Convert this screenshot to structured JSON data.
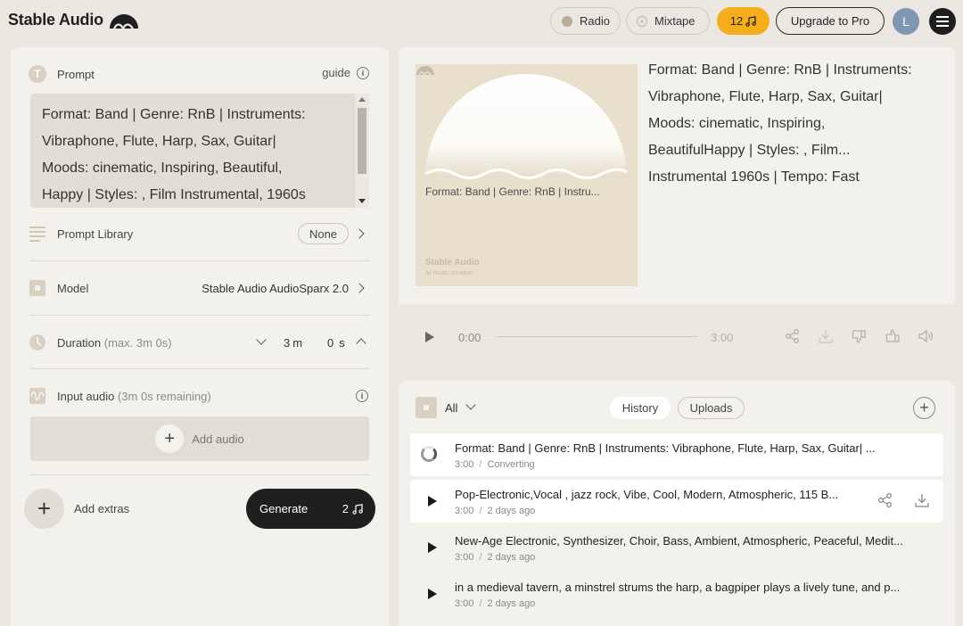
{
  "app": {
    "name": "Stable Audio"
  },
  "topbar": {
    "radio_label": "Radio",
    "mixtape_label": "Mixtape",
    "credits": "12",
    "upgrade_label": "Upgrade to Pro",
    "avatar_initial": "L"
  },
  "prompt": {
    "label": "Prompt",
    "icon_letter": "T",
    "guide_label": "guide",
    "text_lines": [
      "Format: Band | Genre: RnB | Instruments:",
      "Vibraphone, Flute, Harp, Sax, Guitar|",
      "Moods: cinematic, Inspiring, Beautiful,",
      "Happy  | Styles: , Film Instrumental,   1960s"
    ]
  },
  "settings": {
    "prompt_library_label": "Prompt Library",
    "prompt_library_value": "None",
    "model_label": "Model",
    "model_value": "Stable Audio AudioSparx 2.0",
    "duration_label": "Duration",
    "duration_hint": "(max. 3m 0s)",
    "duration_minutes": "3",
    "duration_minutes_unit": "m",
    "duration_seconds": "0",
    "duration_seconds_unit": "s",
    "input_audio_label": "Input audio",
    "input_audio_hint": "(3m 0s remaining)",
    "add_audio_label": "Add audio"
  },
  "actions": {
    "add_extras_label": "Add extras",
    "generate_label": "Generate",
    "generate_cost": "2"
  },
  "player": {
    "cover_caption": "Format: Band | Genre: RnB | Instru...",
    "cover_brand": "Stable Audio",
    "cover_sub": "AI music creation",
    "description_lines": [
      "Format: Band | Genre: RnB | Instruments:",
      "Vibraphone, Flute, Harp, Sax, Guitar|",
      "Moods: cinematic, Inspiring,",
      "BeautifulHappy | Styles: , Film...",
      "Instrumental 1960s | Tempo: Fast"
    ],
    "current_time": "0:00",
    "total_time": "3:00"
  },
  "history": {
    "filter_label": "All",
    "tab_history": "History",
    "tab_uploads": "Uploads",
    "meta_separator": "/",
    "items": [
      {
        "title": "Format: Band | Genre: RnB | Instruments: Vibraphone, Flute, Harp, Sax, Guitar| ...",
        "duration": "3:00",
        "status": "Converting"
      },
      {
        "title": "Pop-Electronic,Vocal , jazz rock, Vibe, Cool, Modern, Atmospheric, 115 B...",
        "duration": "3:00",
        "status": "2 days ago"
      },
      {
        "title": "New-Age Electronic, Synthesizer, Choir, Bass, Ambient, Atmospheric, Peaceful, Medit...",
        "duration": "3:00",
        "status": "2 days ago"
      },
      {
        "title": "in a medieval tavern, a minstrel strums the harp, a bagpiper plays a lively tune, and p...",
        "duration": "3:00",
        "status": "2 days ago"
      }
    ]
  },
  "colors": {
    "background": "#ebe8e2",
    "panel": "#f3f1ec",
    "credits_accent": "#f5ad1b",
    "generate_button": "#1f1f1f"
  }
}
